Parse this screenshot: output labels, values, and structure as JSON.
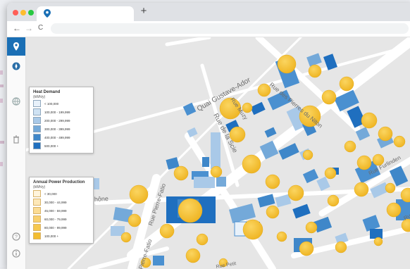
{
  "browser": {
    "tab_icon": "map-pin-icon",
    "new_tab_label": "+",
    "nav_back": "←",
    "nav_forward": "→",
    "nav_reload": "C",
    "menu_icon": "⋮"
  },
  "colors": {
    "blue_dark": "#1f6fbf",
    "blue_mid": "#4a90d0",
    "blue_light": "#a9c9e8",
    "yellow": "#f5c43c",
    "sidebar_accent": "#1a6fb5"
  },
  "sidebar": {
    "items": [
      {
        "icon": "app-logo-icon"
      },
      {
        "icon": "compass-icon"
      },
      {
        "icon": "globe-icon"
      },
      {
        "icon": "trash-icon"
      },
      {
        "icon": "help-icon"
      },
      {
        "icon": "info-icon"
      }
    ]
  },
  "map": {
    "streets": {
      "quai": "Quai Gustave-Ador",
      "pierres": "Rue des Pierres du Niton",
      "scie": "Rue de la Scie",
      "muzy": "Rue Muzy",
      "pierre_fatio_1": "Rue Pierre-Fatio",
      "pierre_fatio_2": "Pierre-Fatio",
      "furlinden": "Rue Furlinden",
      "rhone": "hône",
      "petit": "Rue Petit",
      "rue_r": "Rue"
    }
  },
  "legend_heat": {
    "title": "Heat Demand",
    "unit": "(kWh/y)",
    "rows": [
      {
        "label": "< 100,000",
        "color": "#e8f1fa"
      },
      {
        "label": "100,000 - 199,999",
        "color": "#cfe2f3"
      },
      {
        "label": "200,000 - 299,999",
        "color": "#a9c9e8"
      },
      {
        "label": "300,000 - 399,999",
        "color": "#74a9d9"
      },
      {
        "label": "400,000 - 499,999",
        "color": "#3f87c9"
      },
      {
        "label": "500,000 +",
        "color": "#1f6fbf"
      }
    ]
  },
  "legend_power": {
    "title": "Annual Power Production",
    "unit": "(kWh/y)",
    "rows": [
      {
        "label": "< 30,000",
        "color": "#fff4dc"
      },
      {
        "label": "30,000 - 44,999",
        "color": "#fde8b8"
      },
      {
        "label": "45,000 - 59,999",
        "color": "#fbdc94"
      },
      {
        "label": "60,000 - 79,999",
        "color": "#f8d06e"
      },
      {
        "label": "80,000 - 99,999",
        "color": "#f6c84e"
      },
      {
        "label": "100,000 +",
        "color": "#f3bd30"
      }
    ]
  }
}
